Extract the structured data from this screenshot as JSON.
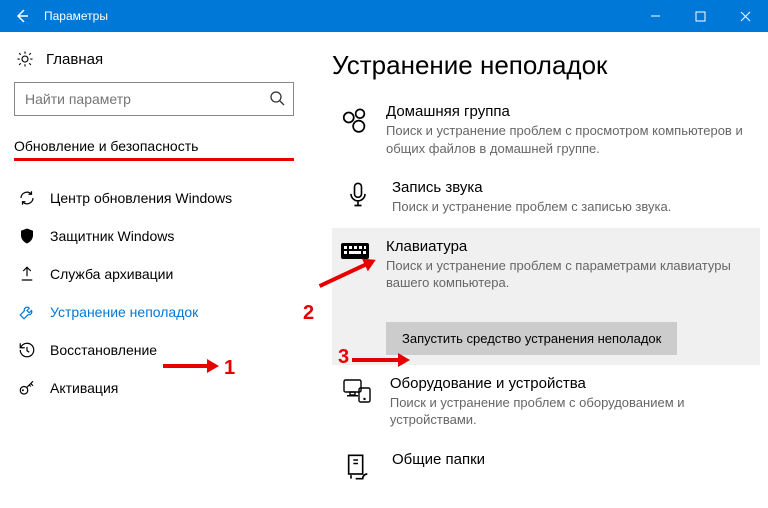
{
  "window": {
    "title": "Параметры"
  },
  "sidebar": {
    "home": "Главная",
    "search_placeholder": "Найти параметр",
    "section": "Обновление и безопасность",
    "items": [
      {
        "label": "Центр обновления Windows"
      },
      {
        "label": "Защитник Windows"
      },
      {
        "label": "Служба архивации"
      },
      {
        "label": "Устранение неполадок"
      },
      {
        "label": "Восстановление"
      },
      {
        "label": "Активация"
      }
    ]
  },
  "main": {
    "title": "Устранение неполадок",
    "items": [
      {
        "title": "Домашняя группа",
        "desc": "Поиск и устранение проблем с просмотром компьютеров и общих файлов в домашней группе."
      },
      {
        "title": "Запись звука",
        "desc": "Поиск и устранение проблем с записью звука."
      },
      {
        "title": "Клавиатура",
        "desc": "Поиск и устранение проблем с параметрами клавиатуры вашего компьютера."
      },
      {
        "title": "Оборудование и устройства",
        "desc": "Поиск и устранение проблем с оборудованием и устройствами."
      },
      {
        "title": "Общие папки",
        "desc": ""
      }
    ],
    "run_button": "Запустить средство устранения неполадок"
  },
  "annotations": {
    "n1": "1",
    "n2": "2",
    "n3": "3"
  }
}
